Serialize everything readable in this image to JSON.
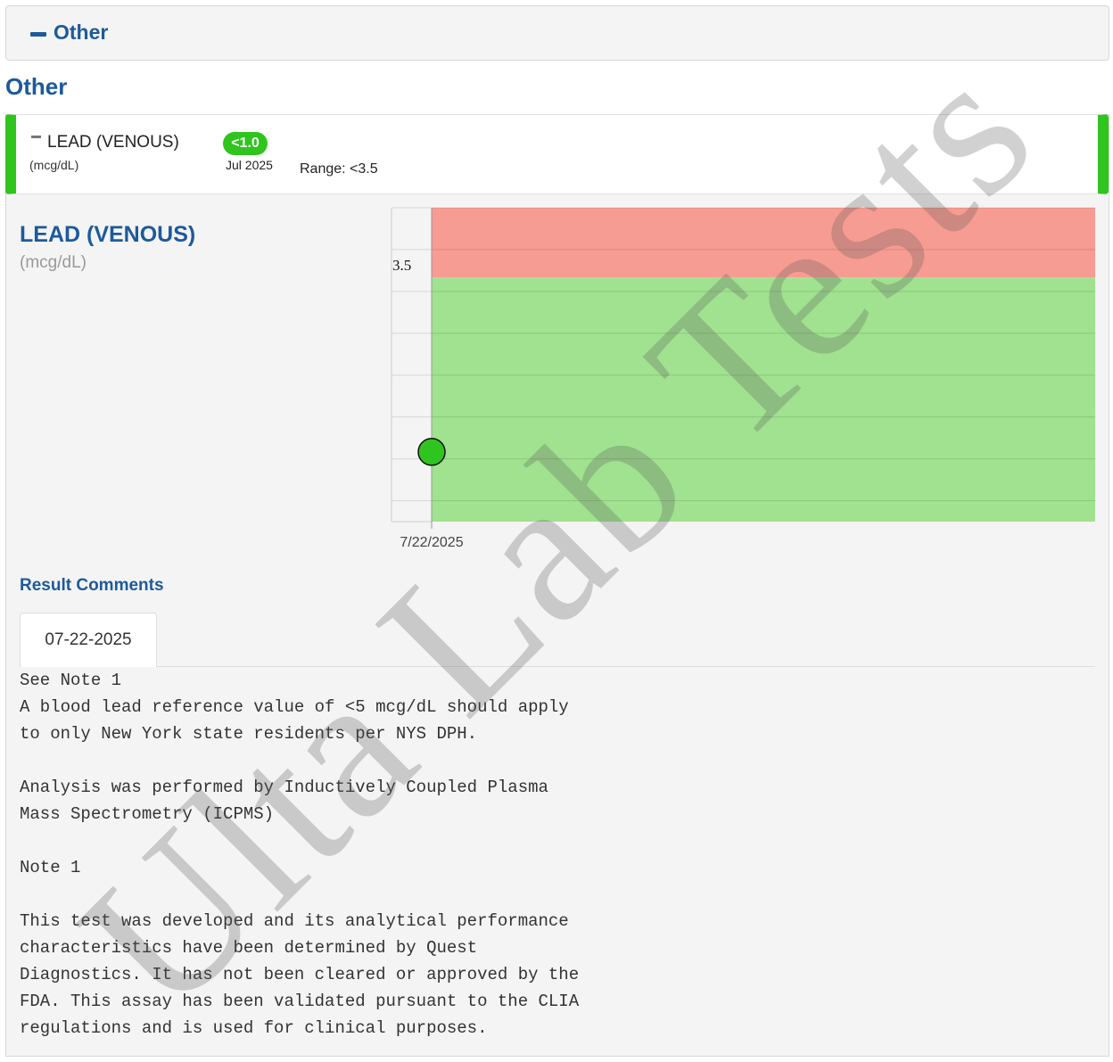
{
  "section": {
    "label": "Other"
  },
  "group": {
    "title": "Other"
  },
  "test_row": {
    "name": "LEAD (VENOUS)",
    "unit": "(mcg/dL)",
    "badge": "<1.0",
    "date": "Jul 2025",
    "range": "Range: <3.5",
    "status_color": "#2fc41e"
  },
  "detail": {
    "title": "LEAD (VENOUS)",
    "unit": "(mcg/dL)"
  },
  "chart_data": {
    "type": "scatter",
    "x": [
      "7/22/2025"
    ],
    "y": [
      1.0
    ],
    "reference_threshold": 3.5,
    "ylim": [
      0,
      4.5
    ],
    "grid": true,
    "ytick_labels": [
      "3.5"
    ],
    "xtick_labels": [
      "7/22/2025"
    ],
    "colors": {
      "normal_band": "#a0e28f",
      "high_band": "#f79c92",
      "point": "#2fc41e"
    }
  },
  "comments": {
    "title": "Result Comments",
    "tab_label": "07-22-2025",
    "lines": [
      "See Note 1",
      "A blood lead reference value of <5 mcg/dL should apply",
      "to only New York state residents per NYS DPH.",
      "",
      "Analysis was performed by Inductively Coupled Plasma",
      "Mass Spectrometry (ICPMS)",
      "",
      "Note 1",
      "",
      "This test was developed and its analytical performance",
      "characteristics have been determined by Quest",
      "Diagnostics. It has not been cleared or approved by the",
      "FDA. This assay has been validated pursuant to the CLIA",
      "regulations and is used for clinical purposes."
    ]
  },
  "watermark": "Ulta Lab Tests"
}
